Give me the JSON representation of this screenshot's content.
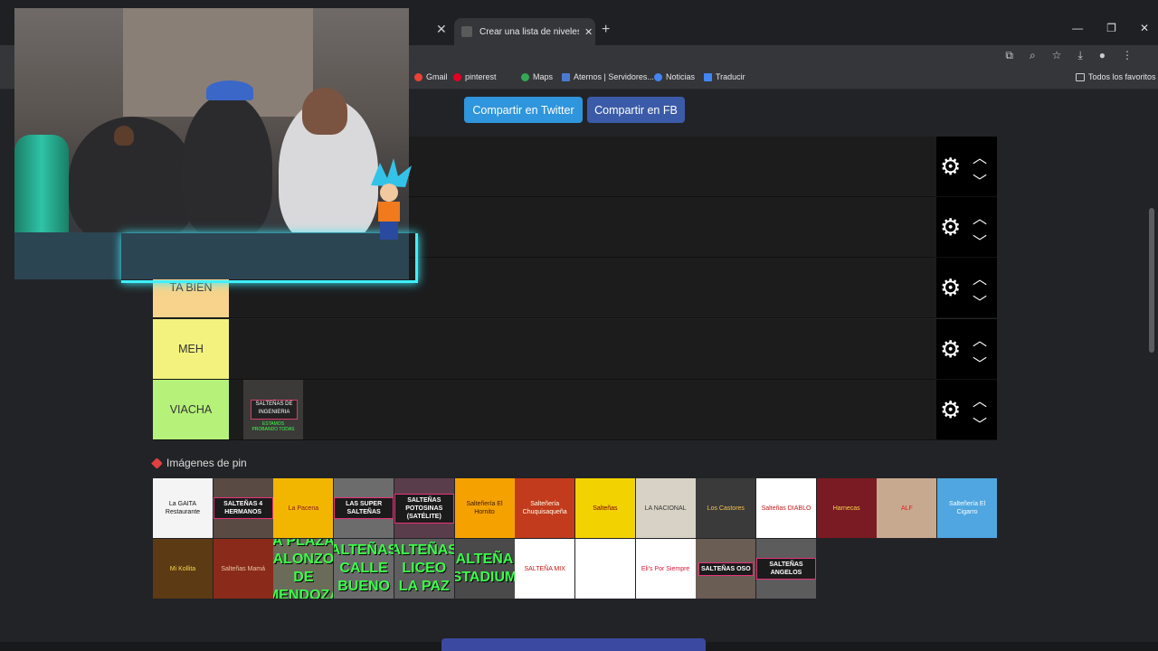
{
  "browser": {
    "active_tab_title": "Crear una lista de niveles de lg",
    "bookmarks": [
      "Gmail",
      "pinterest",
      "Maps",
      "Aternos | Servidores...",
      "Noticias",
      "Traducir",
      "Todos los favoritos"
    ]
  },
  "share": {
    "twitter": "Compartir en Twitter",
    "facebook": "Compartir en FB"
  },
  "tiers": [
    {
      "label": "",
      "color": "#1c1c1d"
    },
    {
      "label": "",
      "color": "#1c1c1d"
    },
    {
      "label": "TA BIEN",
      "color": "#f7d38b"
    },
    {
      "label": "MEH",
      "color": "#f3f27e"
    },
    {
      "label": "VIACHA",
      "color": "#b6f17a"
    }
  ],
  "tier_item": {
    "line1": "SALTEÑAS DE",
    "line2": "INGENIERIA",
    "sub": "ESTAMOS PROBANDO TODAS"
  },
  "pin_heading": "Imágenes de pin",
  "pin_items": [
    {
      "text": "La GAITA Restaurante",
      "bg": "#f4f4f4",
      "fg": "#111"
    },
    {
      "text": "SALTEÑAS 4 HERMANOS",
      "bg": "#5a4a44",
      "fg": "#fff",
      "badge": true
    },
    {
      "text": "La Pacena",
      "bg": "#f2b600",
      "fg": "#8b1a1a"
    },
    {
      "text": "LAS SUPER SALTEÑAS",
      "bg": "#6c6c6c",
      "fg": "#fff",
      "badge": true
    },
    {
      "text": "SALTEÑAS POTOSINAS (SATÉLITE)",
      "bg": "#5a3d4a",
      "fg": "#fff",
      "badge": true
    },
    {
      "text": "Salteñería El Hornito",
      "bg": "#f5a100",
      "fg": "#3a1a00"
    },
    {
      "text": "Salteñería Chuquisaqueña",
      "bg": "#c23b1c",
      "fg": "#ffe"
    },
    {
      "text": "Salteñas",
      "bg": "#f2d200",
      "fg": "#7a0000"
    },
    {
      "text": "LA NACIONAL",
      "bg": "#d7d2c5",
      "fg": "#333"
    },
    {
      "text": "Los Castores",
      "bg": "#3a3a3a",
      "fg": "#f7c24b"
    },
    {
      "text": "Salteñas DIABLO",
      "bg": "#ffffff",
      "fg": "#c41818"
    },
    {
      "text": "Harnecas",
      "bg": "#7a1a22",
      "fg": "#f7d84b"
    },
    {
      "text": "ALF",
      "bg": "#c7a98f",
      "fg": "#e31f1f"
    },
    {
      "text": "Salteñería El Cigarro",
      "bg": "#4fa6e0",
      "fg": "#fff"
    },
    {
      "text": "Mi Kollita",
      "bg": "#5c3a14",
      "fg": "#f7d84b"
    },
    {
      "text": "Salteñas Mamá",
      "bg": "#8a2a1a",
      "fg": "#e8c9a0"
    },
    {
      "text": "A PLAZA ALONZO DE MENDOZA",
      "bg": "#6b6b5a",
      "fg": "#3bff4a",
      "big": true
    },
    {
      "text": "ALTEÑAS CALLE BUENO",
      "bg": "#6a6a6a",
      "fg": "#3bff4a",
      "big": true
    },
    {
      "text": "ALTEÑAS LICEO LA PAZ",
      "bg": "#5e5e5e",
      "fg": "#3bff4a",
      "big": true
    },
    {
      "text": "ALTEÑA STADIUM",
      "bg": "#4a4a4a",
      "fg": "#3bff4a",
      "big": true
    },
    {
      "text": "SALTEÑA MIX",
      "bg": "#ffffff",
      "fg": "#c41818"
    },
    {
      "text": "",
      "bg": "#ffffff",
      "fg": "#5a2a10"
    },
    {
      "text": "Eli's Por Siempre",
      "bg": "#ffffff",
      "fg": "#d41a3a"
    },
    {
      "text": "SALTEÑAS OSO",
      "bg": "#6a5d54",
      "fg": "#fff",
      "badge": true
    },
    {
      "text": "SALTEÑAS ANGELOS",
      "bg": "#5c5c5c",
      "fg": "#fff",
      "badge": true
    }
  ]
}
